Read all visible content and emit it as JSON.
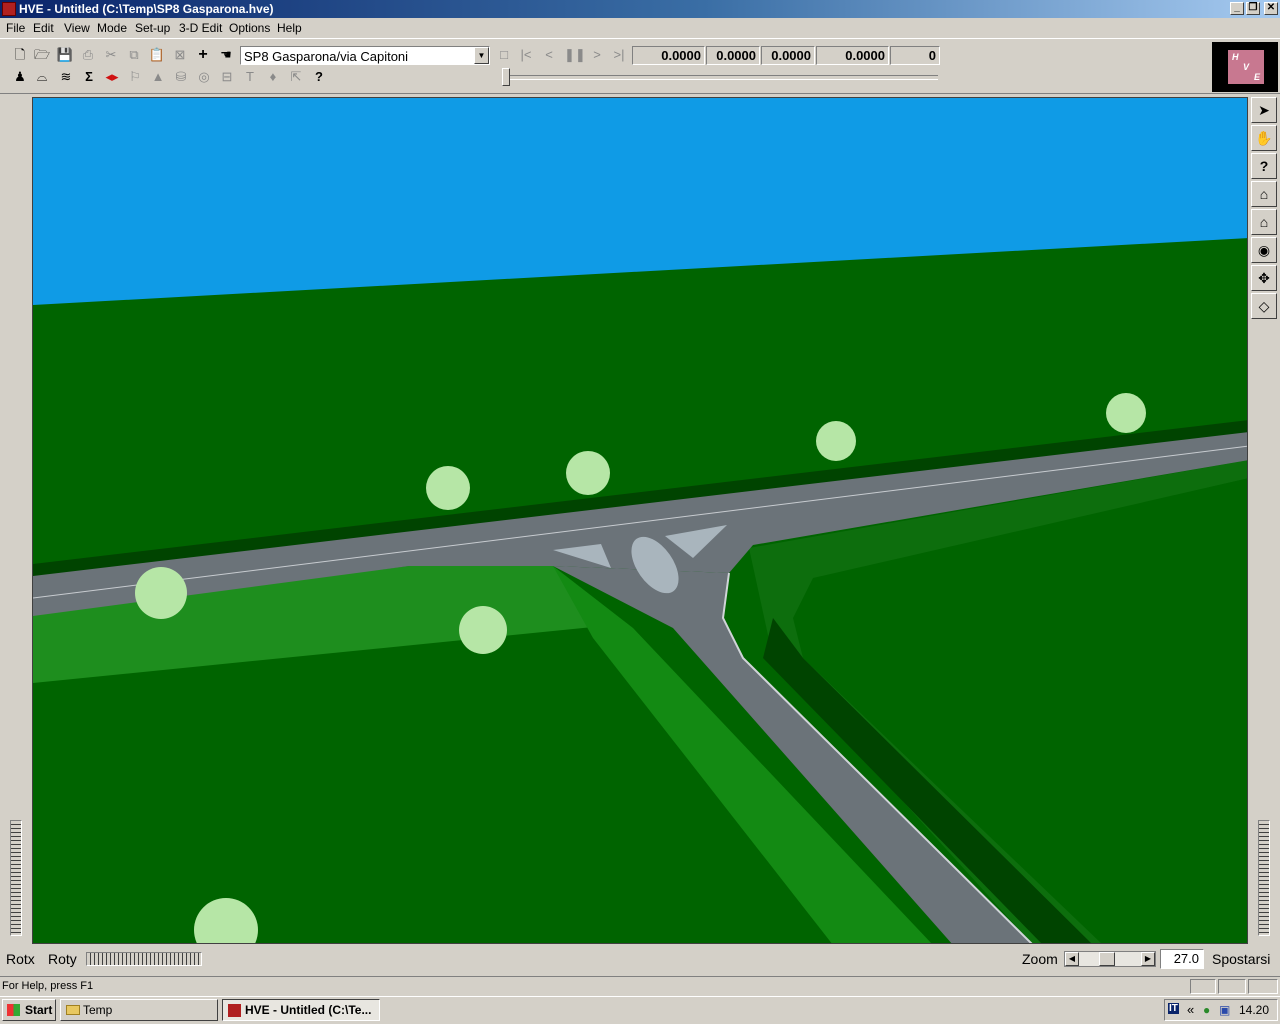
{
  "window": {
    "title": "HVE - Untitled (C:\\Temp\\SP8 Gasparona.hve)"
  },
  "menu": [
    "File",
    "Edit",
    "View",
    "Mode",
    "Set-up",
    "3-D Edit",
    "Options",
    "Help"
  ],
  "toolbar": {
    "location_combo": "SP8 Gasparona/via Capitoni",
    "readouts": [
      "0.0000",
      "0.0000",
      "0.0000",
      "0.0000",
      "0"
    ]
  },
  "logo": {
    "letters": [
      "H",
      "V",
      "E"
    ]
  },
  "rotation": {
    "rotx_label": "Rotx",
    "roty_label": "Roty"
  },
  "zoom": {
    "label": "Zoom",
    "value": "27.0",
    "mode_label": "Spostarsi"
  },
  "status": {
    "help_text": "For Help, press F1"
  },
  "taskbar": {
    "start_label": "Start",
    "items": [
      {
        "label": "Temp",
        "icon": "folder-icon"
      },
      {
        "label": "HVE - Untitled (C:\\Te...",
        "icon": "hve-app-icon"
      }
    ],
    "clock": "14.20",
    "lang": "IT"
  },
  "icons": {
    "toolbar_row1": [
      "new-file-icon",
      "open-folder-icon",
      "save-icon",
      "print-icon",
      "cut-icon",
      "copy-icon",
      "paste-icon",
      "fit-icon",
      "add-icon",
      "hand-pointer-icon"
    ],
    "toolbar_row2": [
      "humans-icon",
      "vehicle-icon",
      "terrain-icon",
      "sum-icon",
      "split-icon",
      "flag-icon",
      "cone-icon",
      "drum-icon",
      "target-icon",
      "barrel-icon",
      "pole-icon",
      "sign-icon",
      "arrow-icon",
      "help-icon"
    ],
    "playback": [
      "stop-icon",
      "first-frame-icon",
      "prev-frame-icon",
      "pause-icon",
      "next-frame-icon",
      "last-frame-icon"
    ],
    "right_tools": [
      "select-arrow-icon",
      "pan-hand-icon",
      "help-query-icon",
      "home-view-icon",
      "set-home-icon",
      "eye-view-icon",
      "move-cross-icon",
      "perspective-cube-icon"
    ]
  }
}
